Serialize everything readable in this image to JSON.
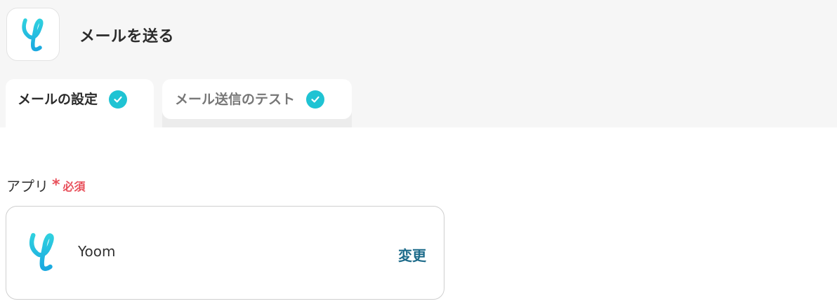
{
  "header": {
    "title": "メールを送る",
    "app_icon": "yoom-logo"
  },
  "tabs": [
    {
      "label": "メールの設定",
      "active": true,
      "completed": true
    },
    {
      "label": "メール送信のテスト",
      "active": false,
      "completed": true
    }
  ],
  "form": {
    "app_label": "アプリ",
    "required_mark": "*",
    "required_text": "必須",
    "app_card": {
      "app_name": "Yoom",
      "change_label": "変更",
      "icon": "yoom-logo"
    }
  },
  "colors": {
    "accent_check": "#1fc3d3",
    "required": "#e8505b",
    "link": "#1d6b8a"
  }
}
